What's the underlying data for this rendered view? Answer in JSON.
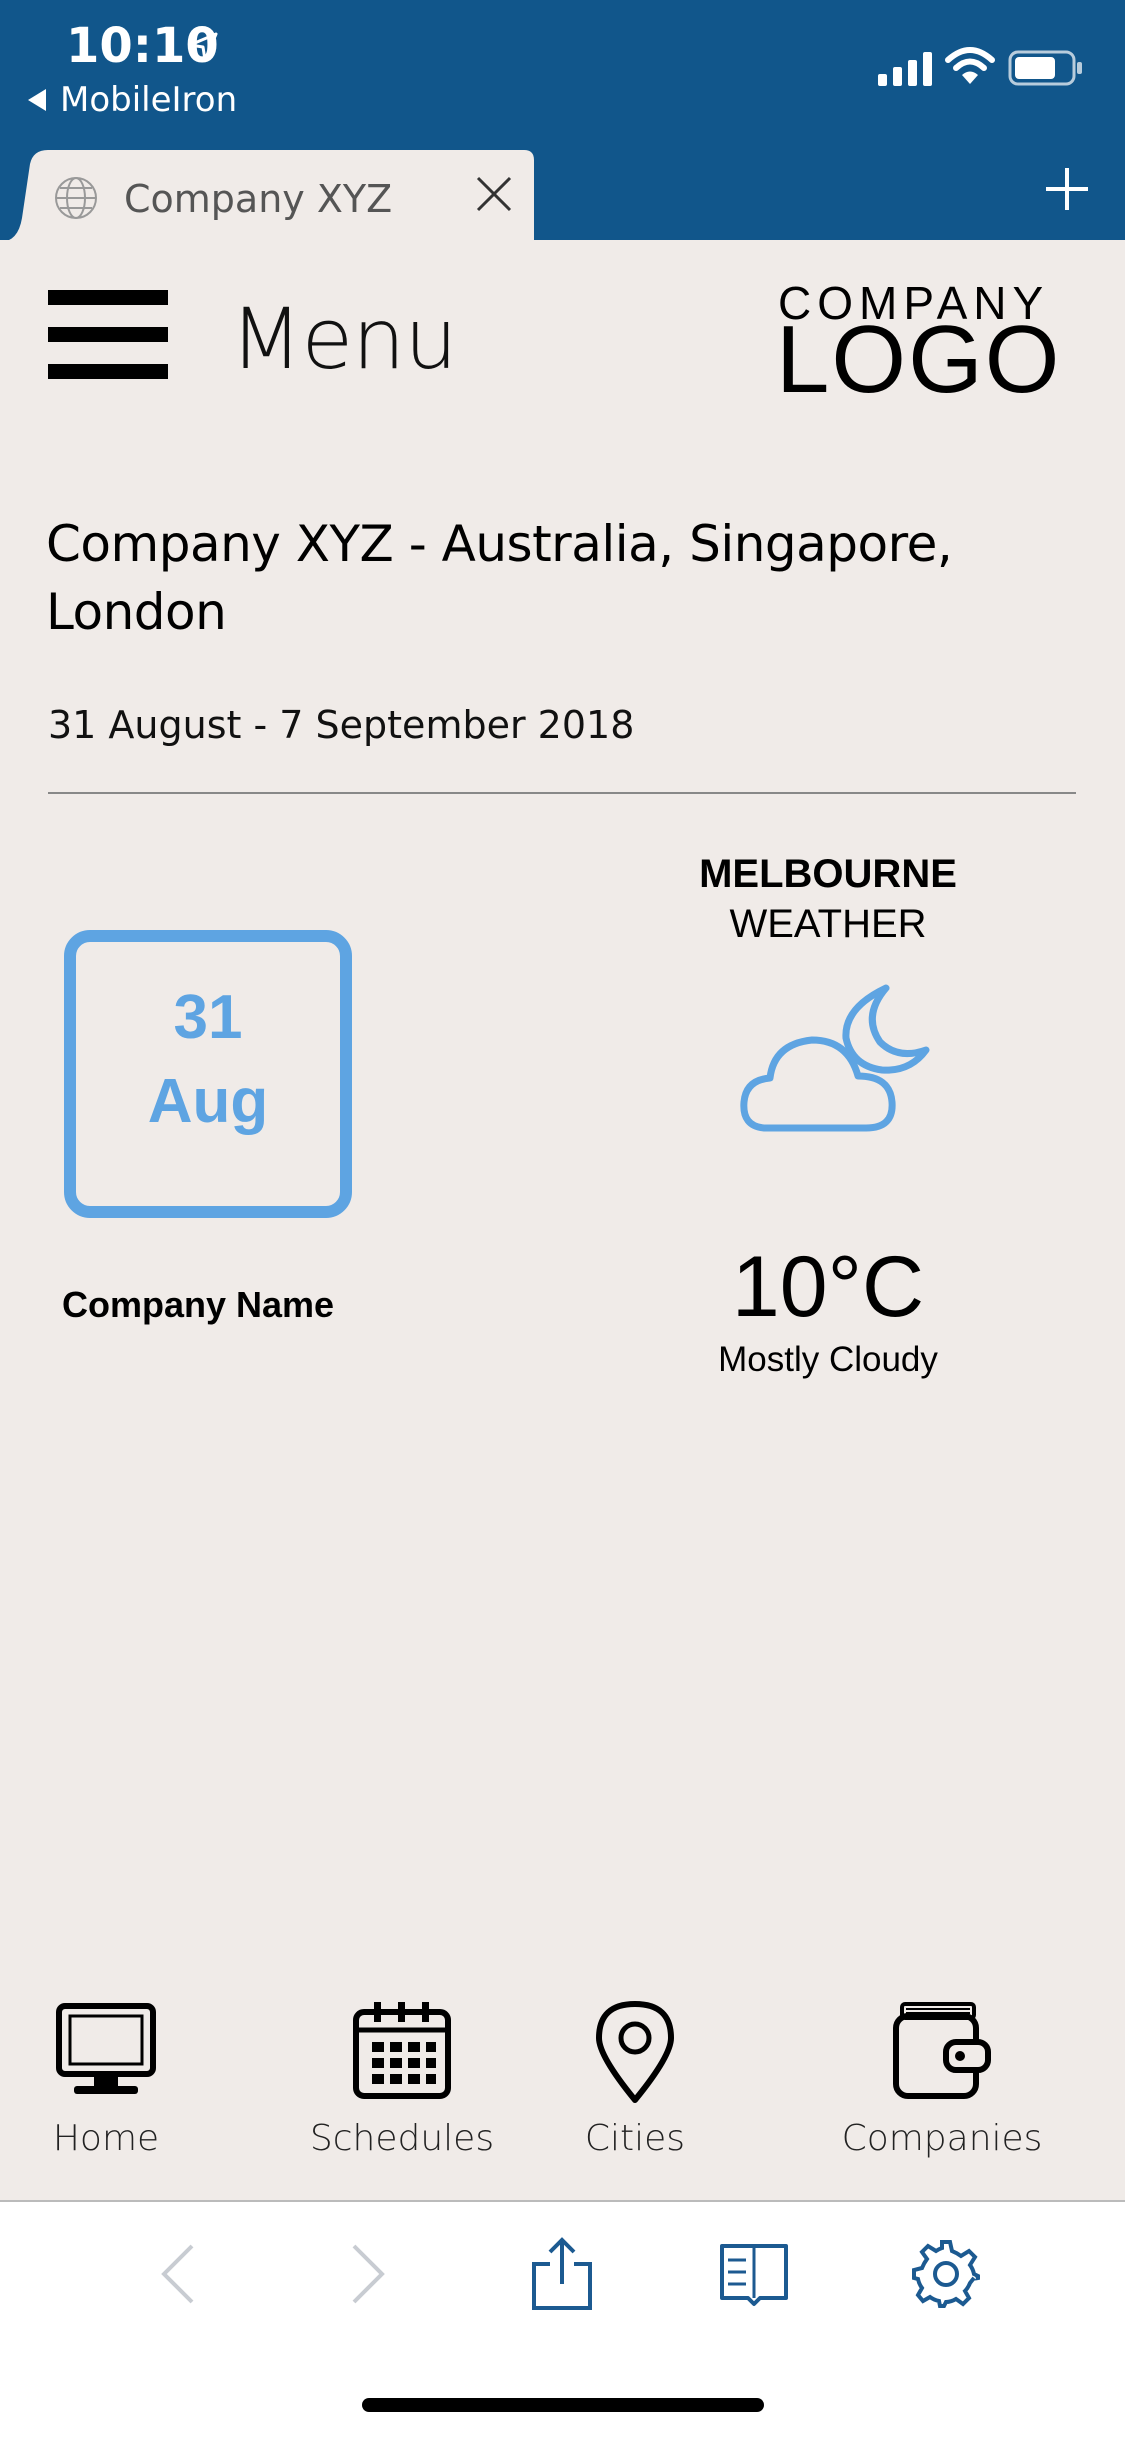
{
  "status_bar": {
    "time": "10:10",
    "back_app": "MobileIron",
    "icons": [
      "location-arrow-icon",
      "signal-icon",
      "wifi-icon",
      "battery-icon"
    ]
  },
  "tab_bar": {
    "tab_title": "Company XYZ",
    "icons": [
      "globe-icon",
      "close-icon",
      "plus-icon"
    ]
  },
  "header": {
    "menu_label": "Menu",
    "logo_line1": "COMPANY",
    "logo_line2": "LOGO"
  },
  "main": {
    "title": "Company XYZ - Australia, Singapore, London",
    "date_range": "31 August - 7 September 2018"
  },
  "calendar": {
    "day": "31",
    "month": "Aug",
    "company_name": "Company Name"
  },
  "weather": {
    "city": "MELBOURNE",
    "label": "WEATHER",
    "temperature": "10°C",
    "condition": "Mostly Cloudy",
    "icon": "cloud-moon-icon"
  },
  "bottom_nav": {
    "items": [
      {
        "label": "Home",
        "icon": "monitor-icon"
      },
      {
        "label": "Schedules",
        "icon": "calendar-icon"
      },
      {
        "label": "Cities",
        "icon": "map-pin-icon"
      },
      {
        "label": "Companies",
        "icon": "wallet-icon"
      }
    ]
  },
  "browser_toolbar": {
    "icons": [
      "back-arrow-icon",
      "forward-arrow-icon",
      "share-icon",
      "reader-icon",
      "settings-gear-icon"
    ]
  },
  "colors": {
    "header_blue": "#11568b",
    "accent_blue": "#5ea4e2",
    "page_bg": "#f0ebe8"
  }
}
